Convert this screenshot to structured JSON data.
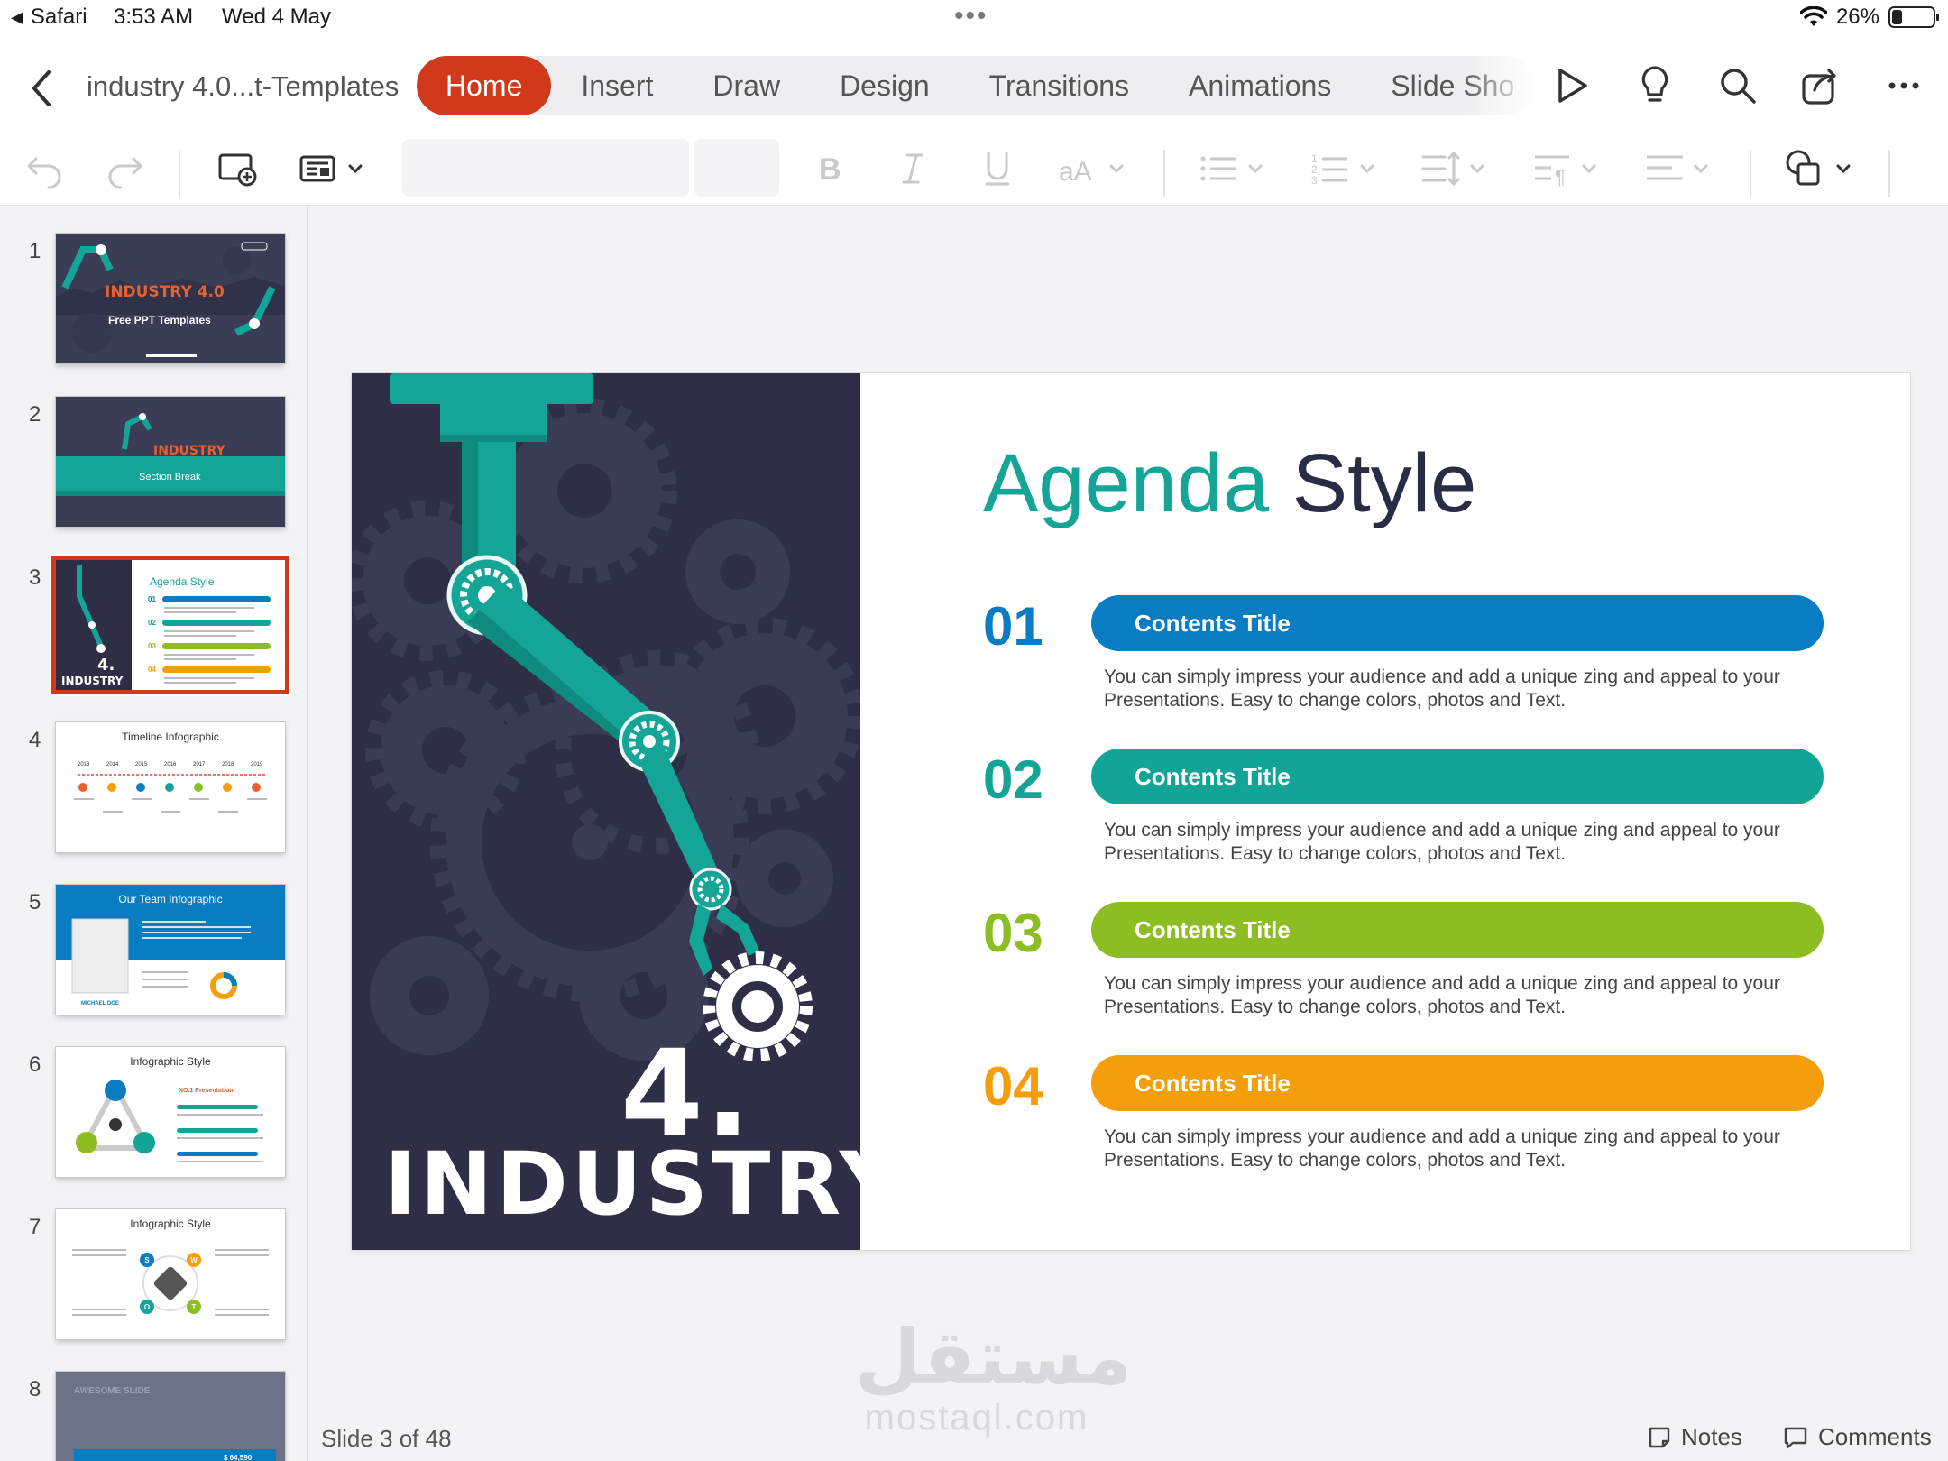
{
  "status_bar": {
    "back_app": "Safari",
    "time": "3:53 AM",
    "date": "Wed 4 May",
    "battery": "26%",
    "battery_level": 0.26
  },
  "header": {
    "doc_title": "industry 4.0...t-Templates",
    "tabs": [
      "Home",
      "Insert",
      "Draw",
      "Design",
      "Transitions",
      "Animations",
      "Slide Sho"
    ],
    "active_tab": "Home"
  },
  "ribbon": {
    "icons": [
      "undo-icon",
      "redo-icon",
      "new-slide-icon",
      "layout-icon",
      "bold-icon",
      "italic-icon",
      "underline-icon",
      "font-size-icon",
      "bullets-icon",
      "numbering-icon",
      "line-spacing-icon",
      "paragraph-icon",
      "align-icon",
      "shapes-icon"
    ]
  },
  "sidebar": {
    "thumbnails": [
      {
        "num": "1",
        "title": "INDUSTRY 4.0",
        "subtitle": "Free PPT Templates"
      },
      {
        "num": "2",
        "title": "INDUSTRY",
        "subtitle": "Section Break"
      },
      {
        "num": "3",
        "title": "Agenda Style",
        "side_4": "4.",
        "side_text": "INDUSTRY",
        "nums": [
          "01",
          "02",
          "03",
          "04"
        ]
      },
      {
        "num": "4",
        "title": "Timeline Infographic",
        "years": [
          "2013",
          "2014",
          "2015",
          "2016",
          "2017",
          "2018",
          "2019"
        ]
      },
      {
        "num": "5",
        "title": "Our Team Infographic",
        "name": "MICHAEL DOE"
      },
      {
        "num": "6",
        "title": "Infographic Style",
        "subtitle": "NO.1 Presentation"
      },
      {
        "num": "7",
        "title": "Infographic Style",
        "letters": [
          "S",
          "W",
          "O",
          "T"
        ]
      },
      {
        "num": "8",
        "title": "AWESOME SLIDE",
        "value": "$ 64,590"
      }
    ]
  },
  "slide": {
    "title_part1": "Agenda",
    "title_part2": "Style",
    "left_4": "4.",
    "left_industry": "INDUSTRY",
    "items": [
      {
        "number": "01",
        "title": "Contents Title",
        "desc": "You can simply impress your audience and add a unique zing and appeal to your Presentations. Easy to change colors, photos and Text.",
        "color": "#0a7dc2"
      },
      {
        "number": "02",
        "title": "Contents Title",
        "desc": "You can simply impress your audience and add a unique zing and appeal to your Presentations. Easy to change colors, photos and Text.",
        "color": "#12a597"
      },
      {
        "number": "03",
        "title": "Contents Title",
        "desc": "You can simply impress your audience and add a unique zing and appeal to your Presentations. Easy to change colors, photos and Text.",
        "color": "#8cbd22"
      },
      {
        "number": "04",
        "title": "Contents Title",
        "desc": "You can simply impress your audience and add a unique zing and appeal to your Presentations. Easy to change colors, photos and Text.",
        "color": "#f59e0b"
      }
    ],
    "panel_color": "#2e2f47",
    "robot_color": "#14a597"
  },
  "footer": {
    "slide_counter": "Slide 3 of 48",
    "notes": "Notes",
    "comments": "Comments"
  },
  "watermark": {
    "arabic": "مستقل",
    "latin": "mostaql.com"
  }
}
